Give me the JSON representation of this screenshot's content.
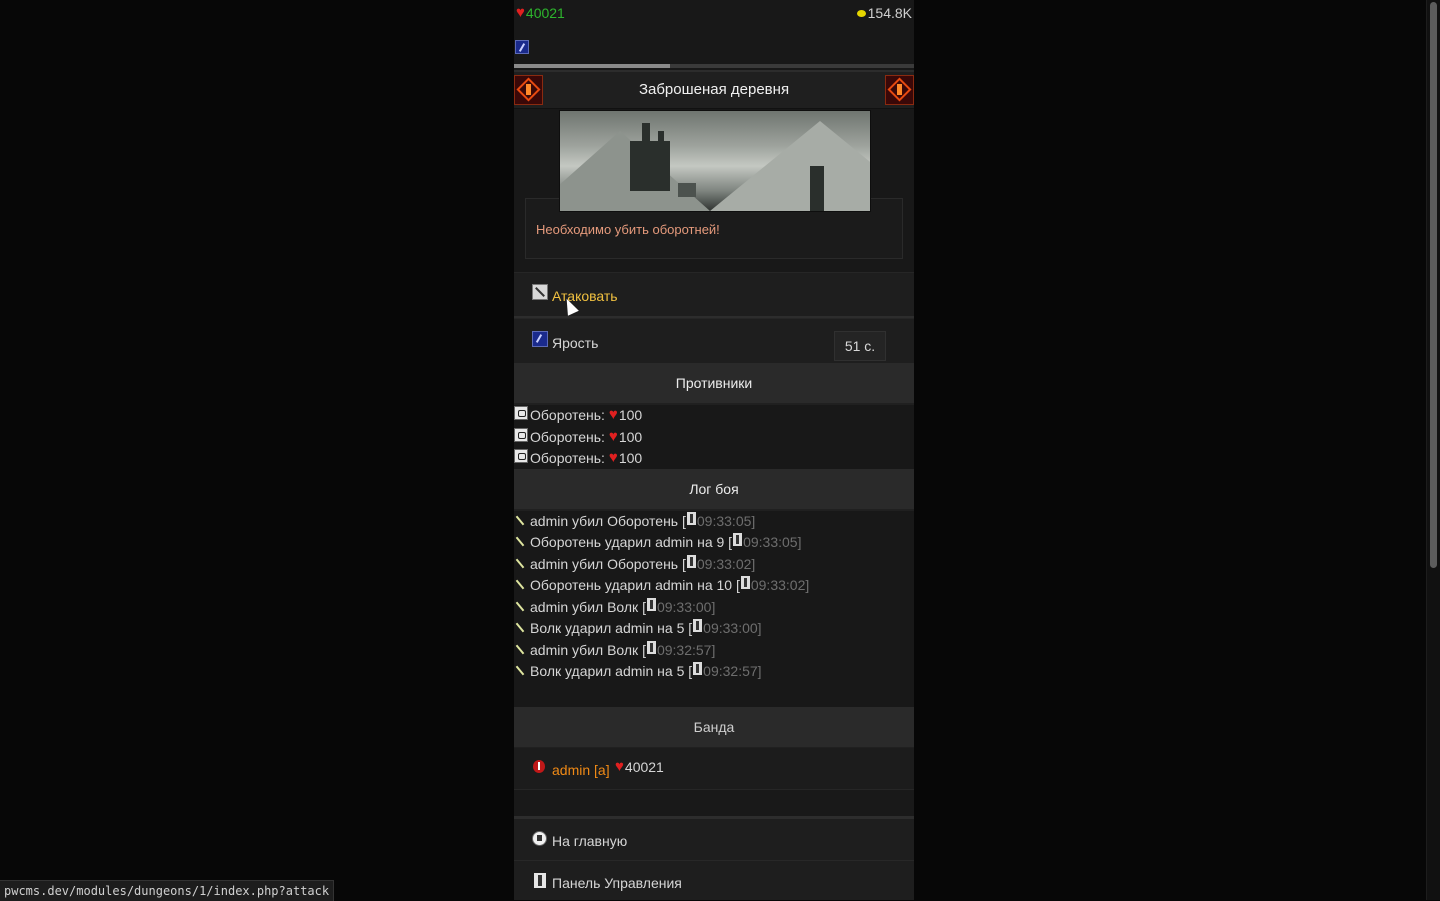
{
  "header": {
    "hp": "40021",
    "gold": "154.8K",
    "progress": 0.39
  },
  "location": {
    "title": "Заброшеная деревня",
    "quest": "Необходимо убить оборотней!"
  },
  "actions": {
    "attack_label": "Атаковать",
    "fury_label": "Ярость",
    "fury_timer": "51 с."
  },
  "enemies": {
    "heading": "Противники",
    "items": [
      {
        "name": "Оборотень:",
        "hp": "100"
      },
      {
        "name": "Оборотень:",
        "hp": "100"
      },
      {
        "name": "Оборотень:",
        "hp": "100"
      }
    ]
  },
  "battle_log": {
    "heading": "Лог боя",
    "entries": [
      {
        "text": "admin убил Оборотень [",
        "time": "09:33:05]"
      },
      {
        "text": "Оборотень ударил admin на 9 [",
        "time": "09:33:05]"
      },
      {
        "text": "admin убил Оборотень [",
        "time": "09:33:02]"
      },
      {
        "text": "Оборотень ударил admin на 10 [",
        "time": "09:33:02]"
      },
      {
        "text": "admin убил Волк [",
        "time": "09:33:00]"
      },
      {
        "text": "Волк ударил admin на 5 [",
        "time": "09:33:00]"
      },
      {
        "text": "admin убил Волк [",
        "time": "09:32:57]"
      },
      {
        "text": "Волк ударил admin на 5 [",
        "time": "09:32:57]"
      }
    ]
  },
  "gang": {
    "heading": "Банда",
    "member_name": "admin [a]",
    "member_hp": "40021"
  },
  "nav": {
    "home": "На главную",
    "panel": "Панель Управления"
  },
  "status_bar": {
    "url": "pwcms.dev/modules/dungeons/1/index.php?attack"
  },
  "colors": {
    "hp_green": "#2db52d",
    "quest_text": "#e59a7c",
    "attack_gold": "#f0c040",
    "gang_orange": "#f08a16"
  }
}
